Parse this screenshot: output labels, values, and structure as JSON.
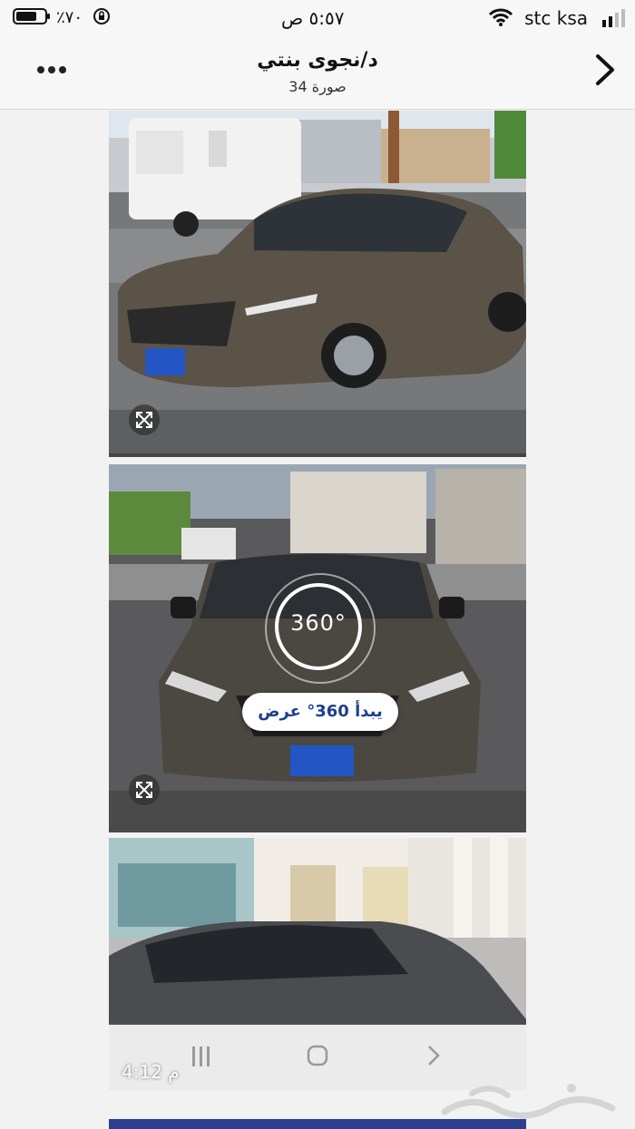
{
  "status_bar": {
    "carrier": "stc ksa",
    "time": "٥:٥٧ ص",
    "battery_percent": "٪٧٠"
  },
  "nav": {
    "title": "د/نجوى بنتي",
    "subtitle": "34 صورة"
  },
  "viewer": {
    "badge_text": "360°",
    "button_label": "يبدأ 360° عرض"
  },
  "photo_overlay": {
    "timestamp": "4:12 م"
  },
  "icons": {
    "back": "chevron-right-icon",
    "more": "more-dots-icon",
    "expand": "expand-icon",
    "wifi": "wifi-icon",
    "lock": "orientation-lock-icon"
  },
  "colors": {
    "car_body": "#5b5347",
    "viewer_text": "#1e3f8f",
    "strip": "#2c3e8f"
  }
}
